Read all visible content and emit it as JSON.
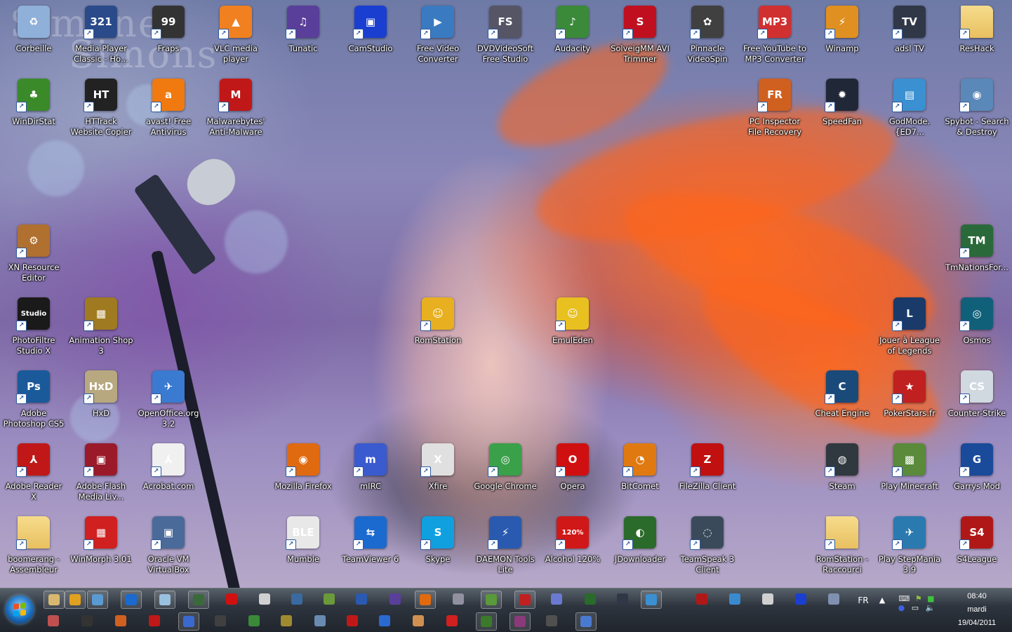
{
  "watermark": [
    "Simone",
    "Simons"
  ],
  "desktop_icons": [
    {
      "label": "Corbeille",
      "icon": "recycle-bin-icon",
      "color": "#8fb0d8",
      "glyph": "♻"
    },
    {
      "label": "Media Player Classic - Ho...",
      "icon": "media-player-classic-icon",
      "color": "#2a4a8a",
      "glyph": "321"
    },
    {
      "label": "Fraps",
      "icon": "fraps-icon",
      "color": "#333333",
      "glyph": "99"
    },
    {
      "label": "VLC media player",
      "icon": "vlc-icon",
      "color": "#f08020",
      "glyph": "▲"
    },
    {
      "label": "Tunatic",
      "icon": "tunatic-icon",
      "color": "#5a3f9a",
      "glyph": "♫"
    },
    {
      "label": "CamStudio",
      "icon": "camstudio-icon",
      "color": "#1a3fd0",
      "glyph": "▣"
    },
    {
      "label": "Free Video Converter",
      "icon": "free-video-converter-icon",
      "color": "#3a7ac0",
      "glyph": "▶"
    },
    {
      "label": "DVDVideoSoft Free Studio",
      "icon": "dvdvideosoft-icon",
      "color": "#555566",
      "glyph": "FS"
    },
    {
      "label": "Audacity",
      "icon": "audacity-icon",
      "color": "#3a8a3a",
      "glyph": "♪"
    },
    {
      "label": "SolveigMM AVI Trimmer",
      "icon": "solveigmm-icon",
      "color": "#c01020",
      "glyph": "S"
    },
    {
      "label": "Pinnacle VideoSpin",
      "icon": "pinnacle-icon",
      "color": "#404040",
      "glyph": "✿"
    },
    {
      "label": "Free YouTube to MP3 Converter",
      "icon": "youtube-mp3-icon",
      "color": "#d03030",
      "glyph": "MP3"
    },
    {
      "label": "Winamp",
      "icon": "winamp-icon",
      "color": "#e09020",
      "glyph": "⚡"
    },
    {
      "label": "adsl TV",
      "icon": "adsl-tv-icon",
      "color": "#303848",
      "glyph": "TV"
    },
    {
      "label": "ResHack",
      "icon": "folder-icon",
      "color": "#e8c060",
      "glyph": ""
    },
    {
      "label": "WinDirStat",
      "icon": "windirstat-icon",
      "color": "#3a8a2a",
      "glyph": "♣"
    },
    {
      "label": "HTTrack Website Copier",
      "icon": "httrack-icon",
      "color": "#222222",
      "glyph": "HT"
    },
    {
      "label": "avast! Free Antivirus",
      "icon": "avast-icon",
      "color": "#f07a10",
      "glyph": "a"
    },
    {
      "label": "Malwarebytes' Anti-Malware",
      "icon": "malwarebytes-icon",
      "color": "#c01818",
      "glyph": "M"
    },
    {
      "label": "PC Inspector File Recovery",
      "icon": "pc-inspector-icon",
      "color": "#d06020",
      "glyph": "FR"
    },
    {
      "label": "SpeedFan",
      "icon": "speedfan-icon",
      "color": "#202838",
      "glyph": "✹"
    },
    {
      "label": "GodMode.{ED7...",
      "icon": "godmode-icon",
      "color": "#3a90d0",
      "glyph": "▤"
    },
    {
      "label": "Spybot - Search & Destroy",
      "icon": "spybot-icon",
      "color": "#5a88b8",
      "glyph": "◉"
    },
    {
      "label": "XN Resource Editor",
      "icon": "xn-resource-editor-icon",
      "color": "#b07030",
      "glyph": "⚙"
    },
    {
      "label": "TmNationsFor...",
      "icon": "tmnations-icon",
      "color": "#2a6a3a",
      "glyph": "TM"
    },
    {
      "label": "PhotoFiltre Studio X",
      "icon": "photofiltre-icon",
      "color": "#1a1a1a",
      "glyph": "Studio"
    },
    {
      "label": "Animation Shop 3",
      "icon": "animation-shop-icon",
      "color": "#a07a20",
      "glyph": "▦"
    },
    {
      "label": "RomStation",
      "icon": "romstation-icon",
      "color": "#e8b020",
      "glyph": "☺"
    },
    {
      "label": "EmulEden",
      "icon": "emuleden-icon",
      "color": "#e8c020",
      "glyph": "☺"
    },
    {
      "label": "Jouer à League of Legends",
      "icon": "league-of-legends-icon",
      "color": "#1a3a6a",
      "glyph": "L"
    },
    {
      "label": "Osmos",
      "icon": "osmos-icon",
      "color": "#10607a",
      "glyph": "◎"
    },
    {
      "label": "Adobe Photoshop CS5",
      "icon": "photoshop-icon",
      "color": "#1a5a9a",
      "glyph": "Ps"
    },
    {
      "label": "HxD",
      "icon": "hxd-icon",
      "color": "#b8a880",
      "glyph": "HxD"
    },
    {
      "label": "OpenOffice.org 3.2",
      "icon": "openoffice-icon",
      "color": "#3a7ad0",
      "glyph": "✈"
    },
    {
      "label": "Cheat Engine",
      "icon": "cheat-engine-icon",
      "color": "#1a4a7a",
      "glyph": "C"
    },
    {
      "label": "PokerStars.fr",
      "icon": "pokerstars-icon",
      "color": "#c02020",
      "glyph": "★"
    },
    {
      "label": "Counter-Strike",
      "icon": "counter-strike-icon",
      "color": "#d0d8e0",
      "glyph": "CS"
    },
    {
      "label": "Adobe Reader X",
      "icon": "adobe-reader-icon",
      "color": "#c01818",
      "glyph": "⅄"
    },
    {
      "label": "Adobe Flash Media Liv...",
      "icon": "adobe-flash-media-icon",
      "color": "#9a1a2a",
      "glyph": "▣"
    },
    {
      "label": "Acrobat.com",
      "icon": "acrobat-com-icon",
      "color": "#f0f0f0",
      "glyph": "⅄"
    },
    {
      "label": "Mozilla Firefox",
      "icon": "firefox-icon",
      "color": "#e06a10",
      "glyph": "◉"
    },
    {
      "label": "mIRC",
      "icon": "mirc-icon",
      "color": "#3a5ad0",
      "glyph": "m"
    },
    {
      "label": "Xfire",
      "icon": "xfire-icon",
      "color": "#e0e0e0",
      "glyph": "X"
    },
    {
      "label": "Google Chrome",
      "icon": "chrome-icon",
      "color": "#3aa04a",
      "glyph": "◎"
    },
    {
      "label": "Opera",
      "icon": "opera-icon",
      "color": "#d01010",
      "glyph": "O"
    },
    {
      "label": "BitComet",
      "icon": "bitcomet-icon",
      "color": "#e07a10",
      "glyph": "◔"
    },
    {
      "label": "FileZilla Client",
      "icon": "filezilla-icon",
      "color": "#c01010",
      "glyph": "Z"
    },
    {
      "label": "Steam",
      "icon": "steam-icon",
      "color": "#303840",
      "glyph": "◍"
    },
    {
      "label": "Play Minecraft",
      "icon": "minecraft-icon",
      "color": "#5a8a3a",
      "glyph": "▩"
    },
    {
      "label": "Garrys Mod",
      "icon": "garrys-mod-icon",
      "color": "#1a4a9a",
      "glyph": "G"
    },
    {
      "label": "boomerang - Assembleur",
      "icon": "folder-icon",
      "color": "#e8c060",
      "glyph": ""
    },
    {
      "label": "WinMorph 3.01",
      "icon": "winmorph-icon",
      "color": "#d02020",
      "glyph": "▦"
    },
    {
      "label": "Oracle VM VirtualBox",
      "icon": "virtualbox-icon",
      "color": "#4a6a9a",
      "glyph": "▣"
    },
    {
      "label": "Mumble",
      "icon": "mumble-icon",
      "color": "#e8e8e8",
      "glyph": "BLE"
    },
    {
      "label": "TeamViewer 6",
      "icon": "teamviewer-icon",
      "color": "#1a6ad0",
      "glyph": "⇆"
    },
    {
      "label": "Skype",
      "icon": "skype-icon",
      "color": "#10a0e0",
      "glyph": "S"
    },
    {
      "label": "DAEMON Tools Lite",
      "icon": "daemon-tools-icon",
      "color": "#2a5ab0",
      "glyph": "⚡"
    },
    {
      "label": "Alcohol 120%",
      "icon": "alcohol-120-icon",
      "color": "#d01818",
      "glyph": "120%"
    },
    {
      "label": "JDownloader",
      "icon": "jdownloader-icon",
      "color": "#2a6a2a",
      "glyph": "◐"
    },
    {
      "label": "TeamSpeak 3 Client",
      "icon": "teamspeak-icon",
      "color": "#3a4a5a",
      "glyph": "◌"
    },
    {
      "label": "RomStation - Raccourci",
      "icon": "folder-icon",
      "color": "#e8c060",
      "glyph": ""
    },
    {
      "label": "Play StepMania 3.9",
      "icon": "stepmania-icon",
      "color": "#2a7ab0",
      "glyph": "✈"
    },
    {
      "label": "S4League",
      "icon": "s4league-icon",
      "color": "#b01818",
      "glyph": "S4"
    }
  ],
  "taskbar": {
    "start_label": "Start",
    "quicklaunch_top": [
      {
        "icon": "explorer-icon",
        "color": "#d8b870",
        "boxed": true
      },
      {
        "icon": "winamp-small-icon",
        "color": "#e0a020",
        "boxed": true
      },
      {
        "icon": "network-icon",
        "color": "#5a9ad0",
        "boxed": true
      },
      {
        "icon": "teamviewer-small-icon",
        "color": "#1a6ad0",
        "boxed": true
      },
      {
        "icon": "notepad-icon",
        "color": "#9ac0e0",
        "boxed": true
      },
      {
        "icon": "terminal-icon",
        "color": "#3a6a3a",
        "boxed": true
      },
      {
        "icon": "opera-small-icon",
        "color": "#d01010",
        "boxed": false
      },
      {
        "icon": "xfire-small-icon",
        "color": "#d0d0d0",
        "boxed": false
      },
      {
        "icon": "cheat-engine-small-icon",
        "color": "#3a6aa0",
        "boxed": false
      },
      {
        "icon": "plant-icon",
        "color": "#6a9a3a",
        "boxed": false
      },
      {
        "icon": "daemon-tools-small-icon",
        "color": "#2a5ab0",
        "boxed": false
      },
      {
        "icon": "tunatic-small-icon",
        "color": "#5a3f9a",
        "boxed": false
      },
      {
        "icon": "firefox-small-icon",
        "color": "#e06a10",
        "boxed": true
      },
      {
        "icon": "controller-icon",
        "color": "#9090a0",
        "boxed": false
      },
      {
        "icon": "winmorph-small-icon",
        "color": "#5a9a3a",
        "boxed": true
      },
      {
        "icon": "flash-small-icon",
        "color": "#c02020",
        "boxed": true
      },
      {
        "icon": "tool-small-icon",
        "color": "#6a7ad0",
        "boxed": false
      },
      {
        "icon": "jdownloader-small-icon",
        "color": "#2a6a2a",
        "boxed": false
      },
      {
        "icon": "speedfan-small-icon",
        "color": "#303848",
        "boxed": false
      },
      {
        "icon": "monitor-small-icon",
        "color": "#3a90d0",
        "boxed": true
      }
    ],
    "quicklaunch_bottom": [
      {
        "icon": "edit-small-icon",
        "color": "#c05050",
        "boxed": false
      },
      {
        "icon": "fraps-small-icon",
        "color": "#333333",
        "boxed": false
      },
      {
        "icon": "chrome-small-icon",
        "color": "#d06020",
        "boxed": false
      },
      {
        "icon": "malware-small-icon",
        "color": "#c01818",
        "boxed": false
      },
      {
        "icon": "camstudio-small-icon",
        "color": "#3a6ad0",
        "boxed": true
      },
      {
        "icon": "pinnacle-small-icon",
        "color": "#404040",
        "boxed": false
      },
      {
        "icon": "audacity-small-icon",
        "color": "#3a8a3a",
        "boxed": false
      },
      {
        "icon": "league-small-icon",
        "color": "#a08a30",
        "boxed": false
      },
      {
        "icon": "network-drive-small-icon",
        "color": "#6a8ab0",
        "boxed": false
      },
      {
        "icon": "malwarebytes-small-icon",
        "color": "#c01818",
        "boxed": false
      },
      {
        "icon": "vlc-small-icon",
        "color": "#2a6ad0",
        "boxed": false
      },
      {
        "icon": "user-small-icon",
        "color": "#d09050",
        "boxed": false
      },
      {
        "icon": "pokerstars-small-icon",
        "color": "#d02020",
        "boxed": false
      },
      {
        "icon": "jdownloader-small-icon-2",
        "color": "#3a7a2a",
        "boxed": true
      },
      {
        "icon": "winrar-small-icon",
        "color": "#8a3a7a",
        "boxed": true
      },
      {
        "icon": "photofiltre-small-icon",
        "color": "#505050",
        "boxed": false
      },
      {
        "icon": "globe-small-icon",
        "color": "#4a7ad0",
        "boxed": true
      }
    ],
    "tray_icons": [
      {
        "icon": "s4league-tray-icon",
        "color": "#b01818"
      },
      {
        "icon": "doc-tray-icon",
        "color": "#3a8ad0"
      },
      {
        "icon": "steam-tray-icon",
        "color": "#d0d0d0"
      },
      {
        "icon": "camstudio-tray-icon",
        "color": "#1a3fd0"
      },
      {
        "icon": "virtualbox-tray-icon",
        "color": "#8090b0"
      }
    ],
    "language": "FR",
    "time": "08:40",
    "day": "mardi",
    "date": "19/04/2011"
  }
}
